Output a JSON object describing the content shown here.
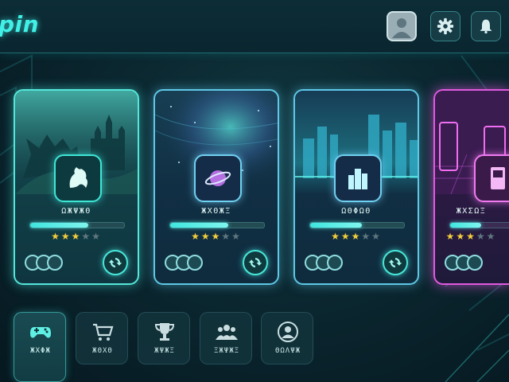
{
  "header": {
    "logo_text": "pin",
    "buttons": [
      {
        "name": "profile-avatar",
        "icon": "user-avatar-icon"
      },
      {
        "name": "settings",
        "icon": "gear-icon"
      },
      {
        "name": "notifications",
        "icon": "bell-icon"
      }
    ]
  },
  "games": [
    {
      "title": "ΩЖΨЖΘ",
      "icon": "dragon-icon",
      "progress": 0.62,
      "rating": 3,
      "max_rating": 5,
      "accent": "#55e6da"
    },
    {
      "title": "ЖΧΘЖΞ",
      "icon": "planet-icon",
      "progress": 0.62,
      "rating": 3,
      "max_rating": 5,
      "accent": "#5fc8e6"
    },
    {
      "title": "ΩΘΦΩΘ",
      "icon": "city-icon",
      "progress": 0.55,
      "rating": 3,
      "max_rating": 5,
      "accent": "#5fc8e6"
    },
    {
      "title": "ЖΧΣΩΞ",
      "icon": "arcade-icon",
      "progress": 0.5,
      "rating": 3,
      "max_rating": 5,
      "accent": "#e05ae0"
    }
  ],
  "nav": [
    {
      "label": "ЖΧΦЖ",
      "icon": "gamepad-icon",
      "active": true
    },
    {
      "label": "ЖΘΧΘ",
      "icon": "cart-icon",
      "active": false
    },
    {
      "label": "ЖΨЖΞ",
      "icon": "trophy-icon",
      "active": false
    },
    {
      "label": "ΞЖΨЖΞ",
      "icon": "friends-icon",
      "active": false
    },
    {
      "label": "ΘΩΛΨЖ",
      "icon": "profile-icon",
      "active": false
    }
  ],
  "colors": {
    "accent_teal": "#41f0e6",
    "accent_pink": "#e05ae0",
    "star_on": "#f3cf3c",
    "star_off": "#5f7880",
    "background": "#0b2730"
  }
}
